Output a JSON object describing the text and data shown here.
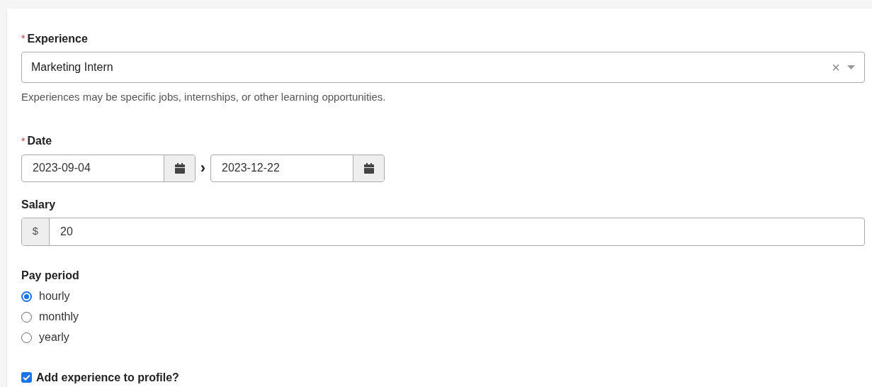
{
  "experience": {
    "required_mark": "*",
    "label": "Experience",
    "value": "Marketing Intern",
    "clear": "×",
    "help": "Experiences may be specific jobs, internships, or other learning opportunities."
  },
  "date": {
    "required_mark": "*",
    "label": "Date",
    "start": "2023-09-04",
    "separator": "›",
    "end": "2023-12-22"
  },
  "salary": {
    "label": "Salary",
    "prefix": "$",
    "value": "20"
  },
  "pay_period": {
    "label": "Pay period",
    "options": [
      {
        "label": "hourly",
        "selected": true
      },
      {
        "label": "monthly",
        "selected": false
      },
      {
        "label": "yearly",
        "selected": false
      }
    ]
  },
  "add_to_profile": {
    "label": "Add experience to profile?",
    "checked": true
  }
}
